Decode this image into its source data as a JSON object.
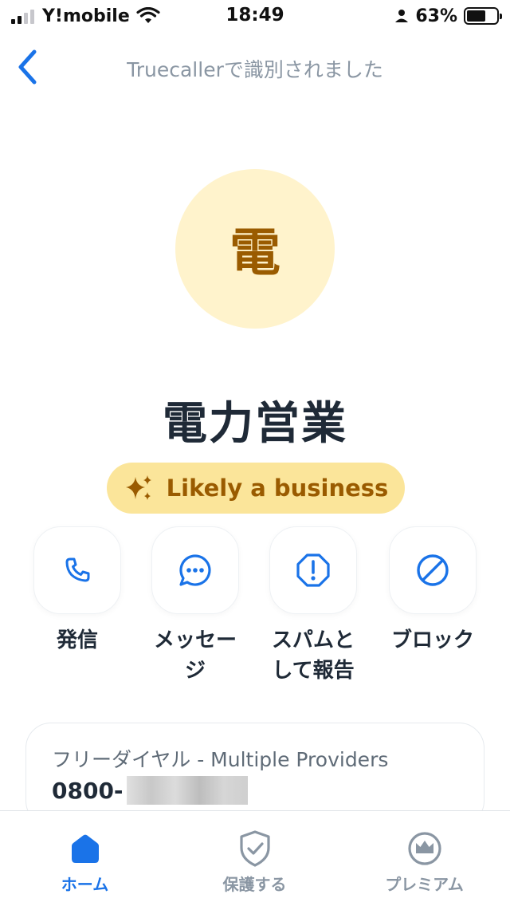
{
  "status_bar": {
    "carrier": "Y!mobile",
    "time": "18:49",
    "battery_percent": "63%",
    "battery_level": 0.63
  },
  "header": {
    "title": "Truecallerで識別されました",
    "back_icon": "chevron-left-icon"
  },
  "contact": {
    "avatar_initial": "電",
    "name": "電力営業",
    "badge_label": "Likely a business",
    "badge_icon": "sparkle-icon"
  },
  "actions": [
    {
      "label": "発信",
      "icon": "phone-icon"
    },
    {
      "label": "メッセージ",
      "icon": "message-icon"
    },
    {
      "label": "スパムとして報告",
      "icon": "spam-report-icon"
    },
    {
      "label": "ブロック",
      "icon": "block-icon"
    }
  ],
  "info_card": {
    "type_label": "フリーダイヤル - Multiple Providers",
    "number_prefix": "0800-"
  },
  "bottom_nav": [
    {
      "label": "ホーム",
      "icon": "home-icon",
      "active": true
    },
    {
      "label": "保護する",
      "icon": "shield-icon",
      "active": false
    },
    {
      "label": "プレミアム",
      "icon": "crown-icon",
      "active": false
    }
  ],
  "colors": {
    "accent": "#1a73e8",
    "avatar_bg": "#fff3cc",
    "badge_bg": "#fbe59a",
    "badge_text": "#9a5b00"
  }
}
